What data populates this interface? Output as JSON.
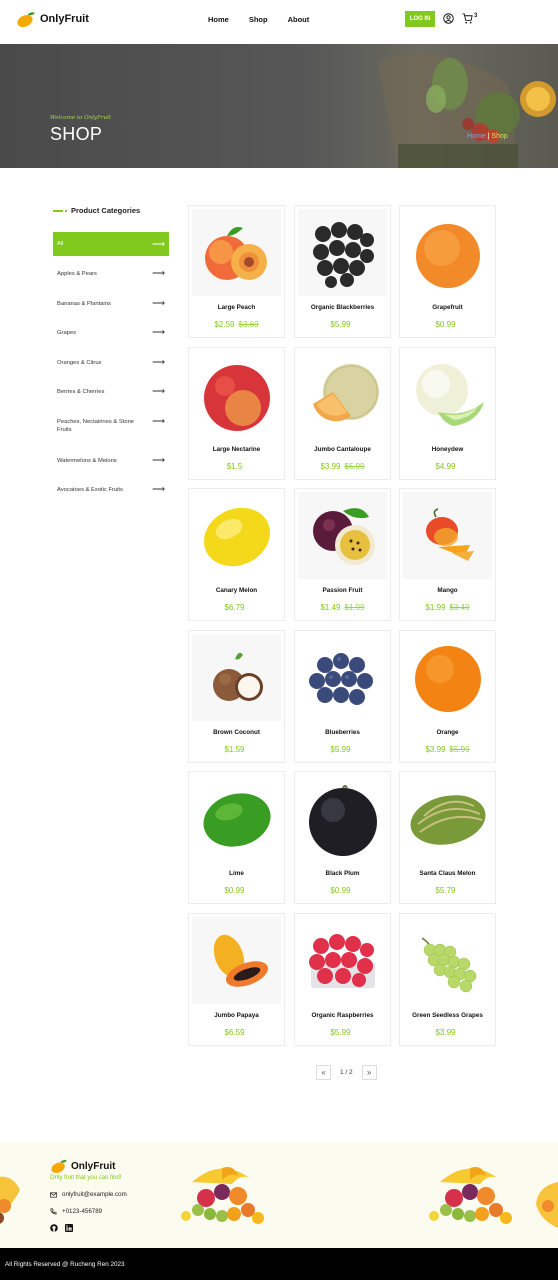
{
  "brand": {
    "name": "OnlyFruit",
    "accent": "#82c91e"
  },
  "nav": {
    "items": [
      "Home",
      "Shop",
      "About"
    ],
    "login_label": "LOG IN",
    "cart_count": "3"
  },
  "hero": {
    "welcome": "Welcome to OnlyFruit",
    "title": "SHOP",
    "breadcrumb_home": "Home",
    "breadcrumb_sep": " | ",
    "breadcrumb_current": "Shop"
  },
  "sidebar": {
    "title": "Product Categories",
    "items": [
      "All",
      "Apples & Pears",
      "Bananas & Plantains",
      "Grapes",
      "Oranges & Citrus",
      "Berries & Cherries",
      "Peaches, Nectairines & Stone Fruits",
      "Watermelons & Melons",
      "Avocatoes & Exotic Fruits"
    ]
  },
  "products": [
    {
      "name": "Large Peach",
      "price": "$2.59",
      "old_price": "$3.69",
      "icon": "peach"
    },
    {
      "name": "Organic Blackberries",
      "price": "$5.99",
      "old_price": "",
      "icon": "blackberries"
    },
    {
      "name": "Grapefruit",
      "price": "$0.99",
      "old_price": "",
      "icon": "grapefruit"
    },
    {
      "name": "Large Nectarine",
      "price": "$1.5",
      "old_price": "",
      "icon": "nectarine"
    },
    {
      "name": "Jumbo Cantaloupe",
      "price": "$3.99",
      "old_price": "$5.99",
      "icon": "cantaloupe"
    },
    {
      "name": "Honeydew",
      "price": "$4.99",
      "old_price": "",
      "icon": "honeydew"
    },
    {
      "name": "Canary Melon",
      "price": "$6.79",
      "old_price": "",
      "icon": "canary-melon"
    },
    {
      "name": "Passion Fruit",
      "price": "$1.49",
      "old_price": "$1.99",
      "icon": "passion-fruit"
    },
    {
      "name": "Mango",
      "price": "$1.99",
      "old_price": "$3.49",
      "icon": "mango"
    },
    {
      "name": "Brown Coconut",
      "price": "$1.59",
      "old_price": "",
      "icon": "coconut"
    },
    {
      "name": "Blueberries",
      "price": "$5.99",
      "old_price": "",
      "icon": "blueberries"
    },
    {
      "name": "Orange",
      "price": "$3.99",
      "old_price": "$5.99",
      "icon": "orange"
    },
    {
      "name": "Lime",
      "price": "$0.99",
      "old_price": "",
      "icon": "lime"
    },
    {
      "name": "Black Plum",
      "price": "$0.99",
      "old_price": "",
      "icon": "black-plum"
    },
    {
      "name": "Santa Claus Melon",
      "price": "$5.79",
      "old_price": "",
      "icon": "santa-claus-melon"
    },
    {
      "name": "Jumbo Papaya",
      "price": "$6.59",
      "old_price": "",
      "icon": "papaya"
    },
    {
      "name": "Organic Raspberries",
      "price": "$5.99",
      "old_price": "",
      "icon": "raspberries"
    },
    {
      "name": "Green Seedless Grapes",
      "price": "$3.99",
      "old_price": "",
      "icon": "grapes"
    }
  ],
  "pagination": {
    "text": "1 / 2"
  },
  "footer": {
    "brand": "OnlyFruit",
    "tagline": "Only fruit that you can find!",
    "email": "onlyfruit@example.com",
    "phone": "+0123-456789",
    "copyright": "All Rights Reserved @ Rucheng Ren 2023"
  }
}
